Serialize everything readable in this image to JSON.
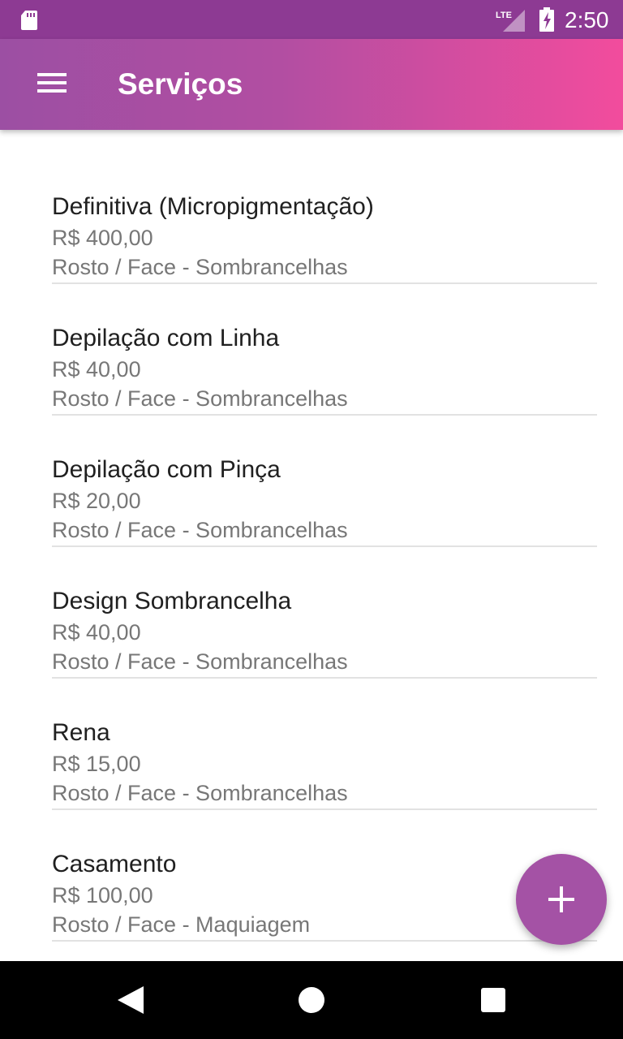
{
  "status_bar": {
    "time": "2:50",
    "network_label": "LTE",
    "icons": [
      "sd-card-icon",
      "lte-signal-icon",
      "battery-charging-icon"
    ]
  },
  "app_bar": {
    "title": "Serviços",
    "menu_icon": "menu-icon",
    "gradient_colors": [
      "#9c4fa3",
      "#f24c9d"
    ]
  },
  "services": [
    {
      "name": "Definitiva (Micropigmentação)",
      "price": "R$ 400,00",
      "category": "Rosto / Face - Sombrancelhas"
    },
    {
      "name": "Depilação com Linha",
      "price": "R$ 40,00",
      "category": "Rosto / Face - Sombrancelhas"
    },
    {
      "name": "Depilação com Pinça",
      "price": "R$ 20,00",
      "category": "Rosto / Face - Sombrancelhas"
    },
    {
      "name": "Design Sombrancelha",
      "price": "R$ 40,00",
      "category": "Rosto / Face - Sombrancelhas"
    },
    {
      "name": "Rena",
      "price": "R$ 15,00",
      "category": "Rosto / Face - Sombrancelhas"
    },
    {
      "name": "Casamento",
      "price": "R$ 100,00",
      "category": "Rosto / Face - Maquiagem"
    }
  ],
  "fab": {
    "icon": "add-icon",
    "color": "#a452a5"
  },
  "nav_bar": {
    "icons": [
      "back-icon",
      "home-icon",
      "recents-icon"
    ]
  }
}
